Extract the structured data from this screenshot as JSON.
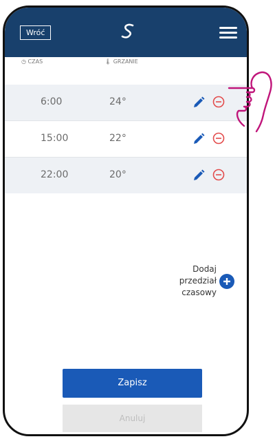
{
  "header": {
    "back_label": "Wróć",
    "bg_color": "#18406c"
  },
  "columns": {
    "time_header": "CZAS",
    "heating_header": "GRZANIE"
  },
  "schedule": [
    {
      "time": "6:00",
      "temp": "24°"
    },
    {
      "time": "15:00",
      "temp": "22°"
    },
    {
      "time": "22:00",
      "temp": "20°"
    }
  ],
  "add_interval": {
    "label_line1": "Dodaj",
    "label_line2": "przedział",
    "label_line3": "czasowy"
  },
  "actions": {
    "save_label": "Zapisz",
    "cancel_label": "Anuluj"
  },
  "colors": {
    "accent_blue": "#1a5ab7",
    "remove_red": "#e34b4b",
    "hand_pink": "#c0157a"
  },
  "icons": [
    "app-logo-icon",
    "menu-icon",
    "time-icon",
    "thermometer-icon",
    "edit-icon",
    "remove-icon",
    "add-icon",
    "pointing-hand-icon"
  ]
}
